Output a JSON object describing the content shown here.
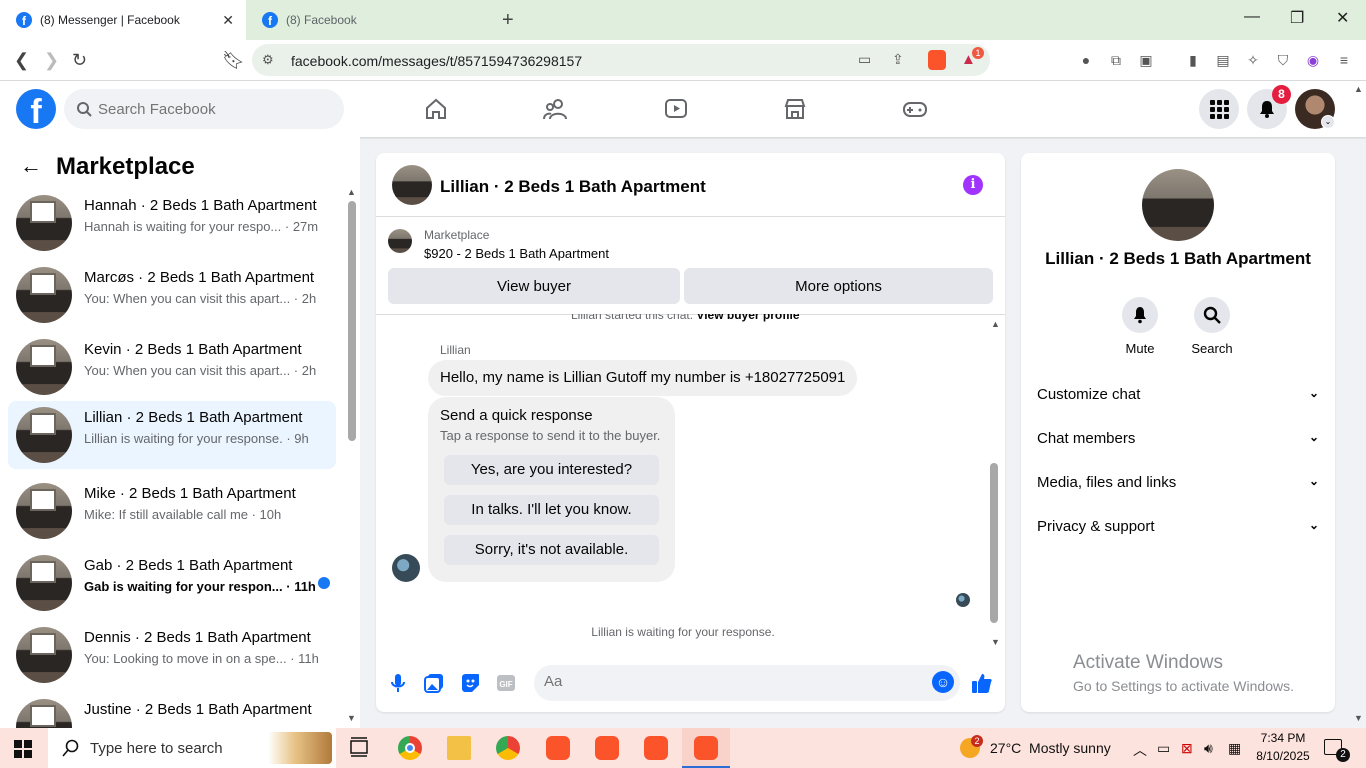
{
  "browser": {
    "tabs": [
      {
        "label": "(8) Messenger | Facebook"
      },
      {
        "label": "(8) Facebook"
      }
    ],
    "url": "facebook.com/messages/t/8571594736298157",
    "ext_badge": "1"
  },
  "fb": {
    "search_placeholder": "Search Facebook",
    "notif_count": "8"
  },
  "sidebar": {
    "title": "Marketplace",
    "items": [
      {
        "name": "Hannah · 2 Beds 1 Bath Apartment",
        "sub": "Hannah is waiting for your respo... · 27m"
      },
      {
        "name": "Marcøs · 2 Beds 1 Bath Apartment",
        "sub": "You: When you can visit this apart... · 2h"
      },
      {
        "name": "Kevin · 2 Beds 1 Bath Apartment",
        "sub": "You: When you can visit this apart... · 2h"
      },
      {
        "name": "Lillian · 2 Beds 1 Bath Apartment",
        "sub": "Lillian is waiting for your response. · 9h"
      },
      {
        "name": "Mike · 2 Beds 1 Bath Apartment",
        "sub": "Mike: If still available call me · 10h"
      },
      {
        "name": "Gab · 2 Beds 1 Bath Apartment",
        "sub": "Gab is waiting for your respon... · 11h"
      },
      {
        "name": "Dennis · 2 Beds 1 Bath Apartment",
        "sub": "You: Looking to move in on a spe... · 11h"
      },
      {
        "name": "Justine · 2 Beds 1 Bath Apartment",
        "sub": ""
      }
    ]
  },
  "chat": {
    "title": "Lillian · 2 Beds 1 Bath Apartment",
    "marketplace_label": "Marketplace",
    "listing": "$920 - 2 Beds 1 Bath Apartment",
    "view_buyer": "View buyer",
    "more_options": "More options",
    "started_text": "Lillian started this chat.",
    "started_link": "View buyer profile",
    "sender": "Lillian",
    "message": "Hello, my name is Lillian Gutoff my number is +18027725091",
    "quick_title": "Send a quick response",
    "quick_sub": "Tap a response to send it to the buyer.",
    "quick_options": [
      "Yes, are you interested?",
      "In talks. I'll let you know.",
      "Sorry, it's not available."
    ],
    "waiting": "Lillian is waiting for your response.",
    "composer_placeholder": "Aa"
  },
  "panel": {
    "name": "Lillian · 2 Beds 1 Bath Apartment",
    "mute": "Mute",
    "search": "Search",
    "sections": [
      "Customize chat",
      "Chat members",
      "Media, files and links",
      "Privacy & support"
    ]
  },
  "watermark": {
    "line1": "Activate Windows",
    "line2": "Go to Settings to activate Windows."
  },
  "taskbar": {
    "search_placeholder": "Type here to search",
    "weather": "27°C  Mostly sunny",
    "weather_badge": "2",
    "time": "7:34 PM",
    "date": "8/10/2025",
    "notif": "2"
  }
}
